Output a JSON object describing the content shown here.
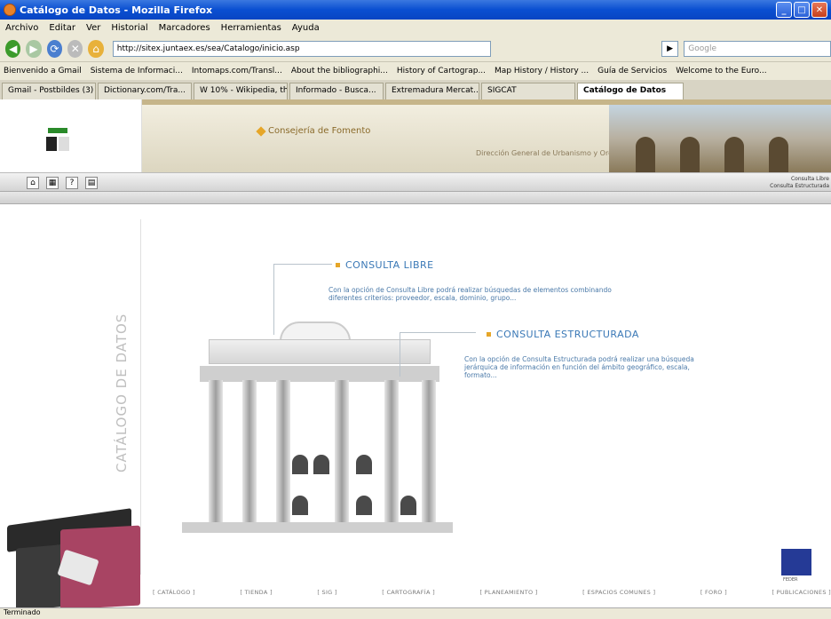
{
  "window": {
    "title": "Catálogo de Datos - Mozilla Firefox"
  },
  "menu": [
    "Archivo",
    "Editar",
    "Ver",
    "Historial",
    "Marcadores",
    "Herramientas",
    "Ayuda"
  ],
  "nav": {
    "url": "http://sitex.juntaex.es/sea/Catalogo/inicio.asp",
    "search_placeholder": "Google"
  },
  "bookmarks": [
    "Bienvenido a Gmail",
    "Sistema de Informaci...",
    "Intomaps.com/Transl...",
    "About the bibliographi...",
    "History of Cartograp...",
    "Map History / History ...",
    "Guía de Servicios",
    "Welcome to the Euro..."
  ],
  "tabs": [
    "Gmail - Postbildes (3)",
    "Dictionary.com/Tra...",
    "W 10% - Wikipedia, th...",
    "Informado - Busca...",
    "Extremadura Mercat...",
    "SIGCAT",
    "Catálogo de Datos"
  ],
  "header": {
    "consejeria": "Consejería de Fomento",
    "direccion": "Dirección General de Urbanismo y Ordenación del Territorio"
  },
  "right_links": {
    "link1": "Consulta Libre",
    "link2": "Consulta Estructurada"
  },
  "side_label": "CATÁLOGO DE DATOS",
  "options": {
    "libre_title": "CONSULTA LIBRE",
    "libre_desc": "Con la opción de Consulta Libre podrá realizar búsquedas de elementos combinando diferentes criterios: proveedor, escala, dominio, grupo...",
    "estructurada_title": "CONSULTA ESTRUCTURADA",
    "estructurada_desc": "Con la opción de Consulta Estructurada podrá realizar una búsqueda jerárquica de información en función del ámbito geográfico, escala, formato..."
  },
  "eu_caption": "FEDER",
  "footer": [
    "[ CATÁLOGO ]",
    "[ TIENDA ]",
    "[ SIG ]",
    "[ CARTOGRAFÍA ]",
    "[ PLANEAMIENTO ]",
    "[ ESPACIOS COMUNES ]",
    "[ FORO ]",
    "[ PUBLICACIONES ]"
  ],
  "status": "Terminado"
}
